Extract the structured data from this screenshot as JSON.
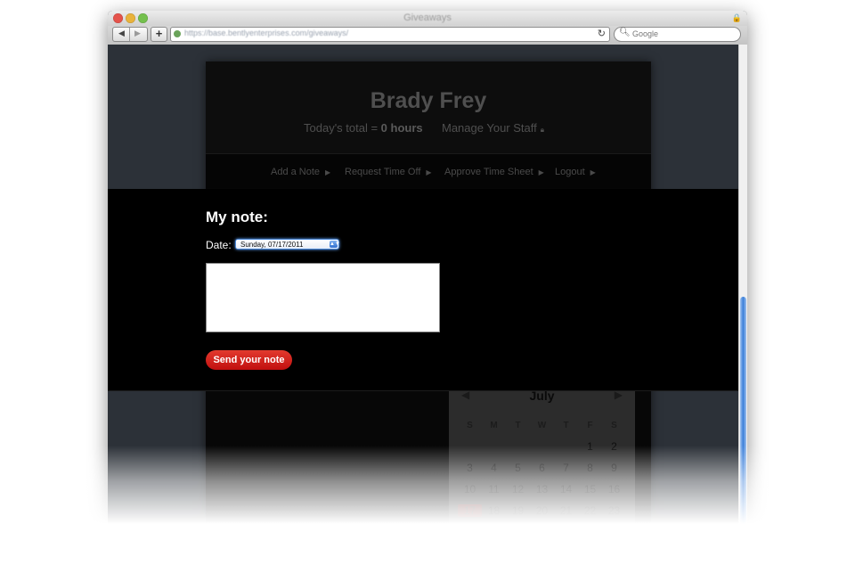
{
  "window": {
    "title": "Giveaways"
  },
  "toolbar": {
    "url": "https://base.bentlyenterprises.com/giveaways/",
    "search_placeholder": "Google",
    "back_icon": "back-arrow-icon",
    "forward_icon": "forward-arrow-icon",
    "add_icon": "plus-icon",
    "reload_icon": "reload-icon"
  },
  "header": {
    "user_name": "Brady Frey",
    "total_label": "Today's total = ",
    "total_value": "0 hours",
    "manage_link": "Manage Your Staff"
  },
  "nav": {
    "items": [
      {
        "label": "Add a Note"
      },
      {
        "label": "Request Time Off"
      },
      {
        "label": "Approve Time Sheet"
      },
      {
        "label": "Logout"
      }
    ]
  },
  "note": {
    "title": "My note:",
    "date_label": "Date:",
    "date_value": "Sunday, 07/17/2011",
    "textarea_value": "",
    "send_label": "Send your note"
  },
  "calendar": {
    "month": "July",
    "weekdays": [
      "S",
      "M",
      "T",
      "W",
      "T",
      "F",
      "S"
    ],
    "weeks": [
      [
        "",
        "",
        "",
        "",
        "",
        "1",
        "2"
      ],
      [
        "3",
        "4",
        "5",
        "6",
        "7",
        "8",
        "9"
      ],
      [
        "10",
        "11",
        "12",
        "13",
        "14",
        "15",
        "16"
      ],
      [
        "17",
        "18",
        "19",
        "20",
        "21",
        "22",
        "23"
      ]
    ],
    "today": "17"
  },
  "colors": {
    "send_button": "#d42a22",
    "page_bg": "#2c3138",
    "note_panel": "#000000"
  }
}
